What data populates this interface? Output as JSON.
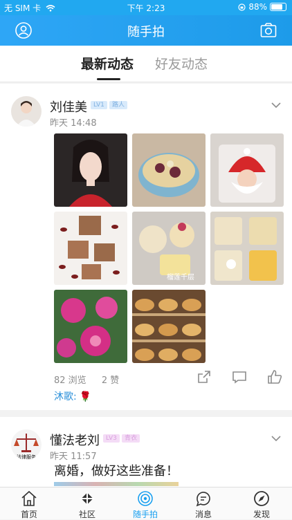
{
  "status_bar": {
    "carrier": "无 SIM 卡",
    "time": "下午 2:23",
    "battery": "88%",
    "battery_level": 0.88
  },
  "header": {
    "title": "随手拍",
    "left_icon": "user-icon",
    "right_icon": "camera-icon"
  },
  "tabs": [
    {
      "label": "最新动态",
      "active": true
    },
    {
      "label": "好友动态",
      "active": false
    }
  ],
  "posts": [
    {
      "user": "刘佳美",
      "level": "LV1",
      "tag": "路人",
      "time": "昨天 14:48",
      "photos": [
        "portrait",
        "soup",
        "santa-cake",
        "dates",
        "dessert-box",
        "mango-cups",
        "peonies",
        "bread"
      ],
      "photo_captions": {
        "dessert-box": "榴莲千层"
      },
      "views_label": "82 浏览",
      "likes_label": "2 赞",
      "comment_author": "沐歌:",
      "comment_text": "🌹"
    },
    {
      "user": "懂法老刘",
      "level": "LV3",
      "tag": "青衣",
      "time": "昨天 11:57",
      "title": "离婚，做好这些准备！",
      "avatar_text": "法律服务"
    }
  ],
  "tabbar": [
    {
      "label": "首页",
      "icon": "home-icon",
      "active": false
    },
    {
      "label": "社区",
      "icon": "community-icon",
      "active": false
    },
    {
      "label": "随手拍",
      "icon": "snapshot-icon",
      "active": true
    },
    {
      "label": "消息",
      "icon": "message-icon",
      "active": false
    },
    {
      "label": "发现",
      "icon": "discover-icon",
      "active": false
    }
  ],
  "colors": {
    "primary": "#1aa0f0",
    "header": "#21a8f0",
    "comment": "#2a8fd9"
  }
}
